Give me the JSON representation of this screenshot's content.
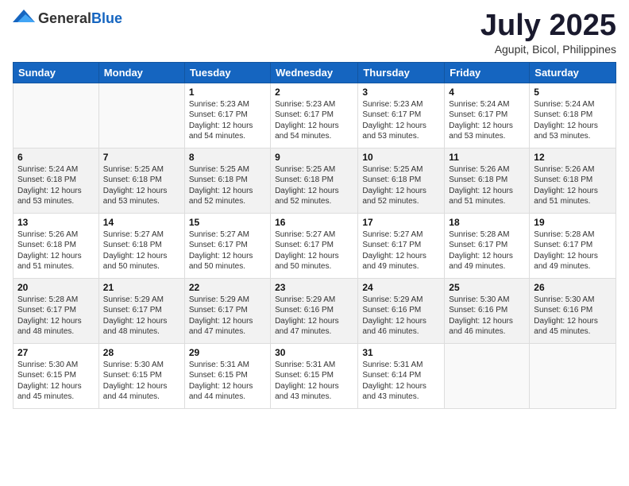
{
  "logo": {
    "general": "General",
    "blue": "Blue"
  },
  "title": "July 2025",
  "subtitle": "Agupit, Bicol, Philippines",
  "days_of_week": [
    "Sunday",
    "Monday",
    "Tuesday",
    "Wednesday",
    "Thursday",
    "Friday",
    "Saturday"
  ],
  "weeks": [
    [
      {
        "day": "",
        "info": ""
      },
      {
        "day": "",
        "info": ""
      },
      {
        "day": "1",
        "info": "Sunrise: 5:23 AM\nSunset: 6:17 PM\nDaylight: 12 hours and 54 minutes."
      },
      {
        "day": "2",
        "info": "Sunrise: 5:23 AM\nSunset: 6:17 PM\nDaylight: 12 hours and 54 minutes."
      },
      {
        "day": "3",
        "info": "Sunrise: 5:23 AM\nSunset: 6:17 PM\nDaylight: 12 hours and 53 minutes."
      },
      {
        "day": "4",
        "info": "Sunrise: 5:24 AM\nSunset: 6:17 PM\nDaylight: 12 hours and 53 minutes."
      },
      {
        "day": "5",
        "info": "Sunrise: 5:24 AM\nSunset: 6:18 PM\nDaylight: 12 hours and 53 minutes."
      }
    ],
    [
      {
        "day": "6",
        "info": "Sunrise: 5:24 AM\nSunset: 6:18 PM\nDaylight: 12 hours and 53 minutes."
      },
      {
        "day": "7",
        "info": "Sunrise: 5:25 AM\nSunset: 6:18 PM\nDaylight: 12 hours and 53 minutes."
      },
      {
        "day": "8",
        "info": "Sunrise: 5:25 AM\nSunset: 6:18 PM\nDaylight: 12 hours and 52 minutes."
      },
      {
        "day": "9",
        "info": "Sunrise: 5:25 AM\nSunset: 6:18 PM\nDaylight: 12 hours and 52 minutes."
      },
      {
        "day": "10",
        "info": "Sunrise: 5:25 AM\nSunset: 6:18 PM\nDaylight: 12 hours and 52 minutes."
      },
      {
        "day": "11",
        "info": "Sunrise: 5:26 AM\nSunset: 6:18 PM\nDaylight: 12 hours and 51 minutes."
      },
      {
        "day": "12",
        "info": "Sunrise: 5:26 AM\nSunset: 6:18 PM\nDaylight: 12 hours and 51 minutes."
      }
    ],
    [
      {
        "day": "13",
        "info": "Sunrise: 5:26 AM\nSunset: 6:18 PM\nDaylight: 12 hours and 51 minutes."
      },
      {
        "day": "14",
        "info": "Sunrise: 5:27 AM\nSunset: 6:18 PM\nDaylight: 12 hours and 50 minutes."
      },
      {
        "day": "15",
        "info": "Sunrise: 5:27 AM\nSunset: 6:17 PM\nDaylight: 12 hours and 50 minutes."
      },
      {
        "day": "16",
        "info": "Sunrise: 5:27 AM\nSunset: 6:17 PM\nDaylight: 12 hours and 50 minutes."
      },
      {
        "day": "17",
        "info": "Sunrise: 5:27 AM\nSunset: 6:17 PM\nDaylight: 12 hours and 49 minutes."
      },
      {
        "day": "18",
        "info": "Sunrise: 5:28 AM\nSunset: 6:17 PM\nDaylight: 12 hours and 49 minutes."
      },
      {
        "day": "19",
        "info": "Sunrise: 5:28 AM\nSunset: 6:17 PM\nDaylight: 12 hours and 49 minutes."
      }
    ],
    [
      {
        "day": "20",
        "info": "Sunrise: 5:28 AM\nSunset: 6:17 PM\nDaylight: 12 hours and 48 minutes."
      },
      {
        "day": "21",
        "info": "Sunrise: 5:29 AM\nSunset: 6:17 PM\nDaylight: 12 hours and 48 minutes."
      },
      {
        "day": "22",
        "info": "Sunrise: 5:29 AM\nSunset: 6:17 PM\nDaylight: 12 hours and 47 minutes."
      },
      {
        "day": "23",
        "info": "Sunrise: 5:29 AM\nSunset: 6:16 PM\nDaylight: 12 hours and 47 minutes."
      },
      {
        "day": "24",
        "info": "Sunrise: 5:29 AM\nSunset: 6:16 PM\nDaylight: 12 hours and 46 minutes."
      },
      {
        "day": "25",
        "info": "Sunrise: 5:30 AM\nSunset: 6:16 PM\nDaylight: 12 hours and 46 minutes."
      },
      {
        "day": "26",
        "info": "Sunrise: 5:30 AM\nSunset: 6:16 PM\nDaylight: 12 hours and 45 minutes."
      }
    ],
    [
      {
        "day": "27",
        "info": "Sunrise: 5:30 AM\nSunset: 6:15 PM\nDaylight: 12 hours and 45 minutes."
      },
      {
        "day": "28",
        "info": "Sunrise: 5:30 AM\nSunset: 6:15 PM\nDaylight: 12 hours and 44 minutes."
      },
      {
        "day": "29",
        "info": "Sunrise: 5:31 AM\nSunset: 6:15 PM\nDaylight: 12 hours and 44 minutes."
      },
      {
        "day": "30",
        "info": "Sunrise: 5:31 AM\nSunset: 6:15 PM\nDaylight: 12 hours and 43 minutes."
      },
      {
        "day": "31",
        "info": "Sunrise: 5:31 AM\nSunset: 6:14 PM\nDaylight: 12 hours and 43 minutes."
      },
      {
        "day": "",
        "info": ""
      },
      {
        "day": "",
        "info": ""
      }
    ]
  ]
}
